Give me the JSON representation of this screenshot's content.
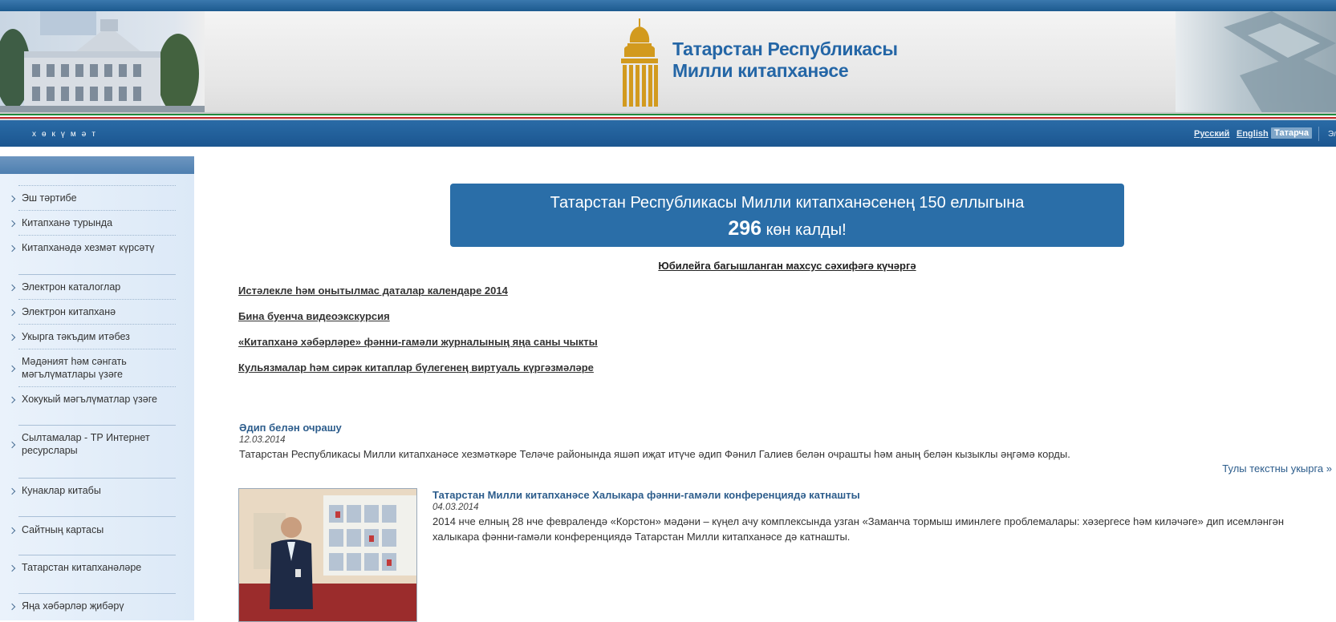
{
  "header": {
    "site_title_line1": "Татарстан Республикасы",
    "site_title_line2": "Милли китапханәсе"
  },
  "navbar": {
    "gov_link": "хөкүмәт",
    "languages": [
      {
        "label": "Русский",
        "active": false
      },
      {
        "label": "English",
        "active": false
      },
      {
        "label": "Татарча",
        "active": true
      }
    ],
    "extra": "Эл"
  },
  "sidebar": {
    "items": [
      {
        "label": "Эш тәртибе"
      },
      {
        "label": "Китапханә турында"
      },
      {
        "label": "Китапханәдә хезмәт күрсәтү"
      },
      {
        "label": "Электрон каталоглар"
      },
      {
        "label": "Электрон китапханә"
      },
      {
        "label": "Укырга тәкъдим итәбез"
      },
      {
        "label": "Мәдәният һәм сәнгать мәгълүматлары үзәге"
      },
      {
        "label": "Хокукый мәгълүматлар үзәге"
      },
      {
        "label": "Сылтамалар - ТР Интернет ресурслары"
      },
      {
        "label": "Кунаклар китабы"
      },
      {
        "label": "Сайтның картасы"
      },
      {
        "label": "Татарстан китапханәләре"
      },
      {
        "label": "Яңа хәбәрләр җибәрү"
      }
    ]
  },
  "banner": {
    "line1": "Татарстан Республикасы Милли китапханәсенең 150 еллыгына",
    "days_number": "296",
    "days_suffix": " көн калды!"
  },
  "main": {
    "jubilee_link": "Юбилейга багышланган махсус сәхифәгә күчәргә",
    "links": [
      "Истәлекле һәм онытылмас даталар календаре 2014",
      "Бина буенча видеоэкскурсия",
      "«Китапханә хәбәрләре» фәнни-гамәли журналының яңа саны чыкты",
      "Кульязмалар һәм сирәк китаплар бүлегенең виртуаль күргәзмәләре"
    ]
  },
  "news": [
    {
      "title": "Әдип белән очрашу",
      "date": "12.03.2014",
      "text": "Татарстан Республикасы Милли китапханәсе хезмәткәре Теләче районында яшәп иҗат итүче әдип Фәнил Галиев белән очрашты һәм аның белән кызыклы әңгәмә корды.",
      "read_more": "Тулы текстны укырга »"
    },
    {
      "title": "Татарстан Милли китапханәсе Халыкара фәнни-гамәли конференциядә катнашты",
      "date": "04.03.2014",
      "text": "2014 нче елның 28 нче февралендә «Корстон» мәдәни – күңел ачу комплексында узган «Заманча тормыш иминлеге проблемалары: хәзергесе һәм киләчәге» дип исемләнгән халыкара фәнни-гамәли конференциядә Татарстан Милли китапханәсе дә катнашты."
    }
  ],
  "colors": {
    "brand_blue": "#2a6ea8",
    "title_blue": "#2466a6",
    "gold": "#d29a1e",
    "sidebar_bg": "#e4eef9"
  }
}
